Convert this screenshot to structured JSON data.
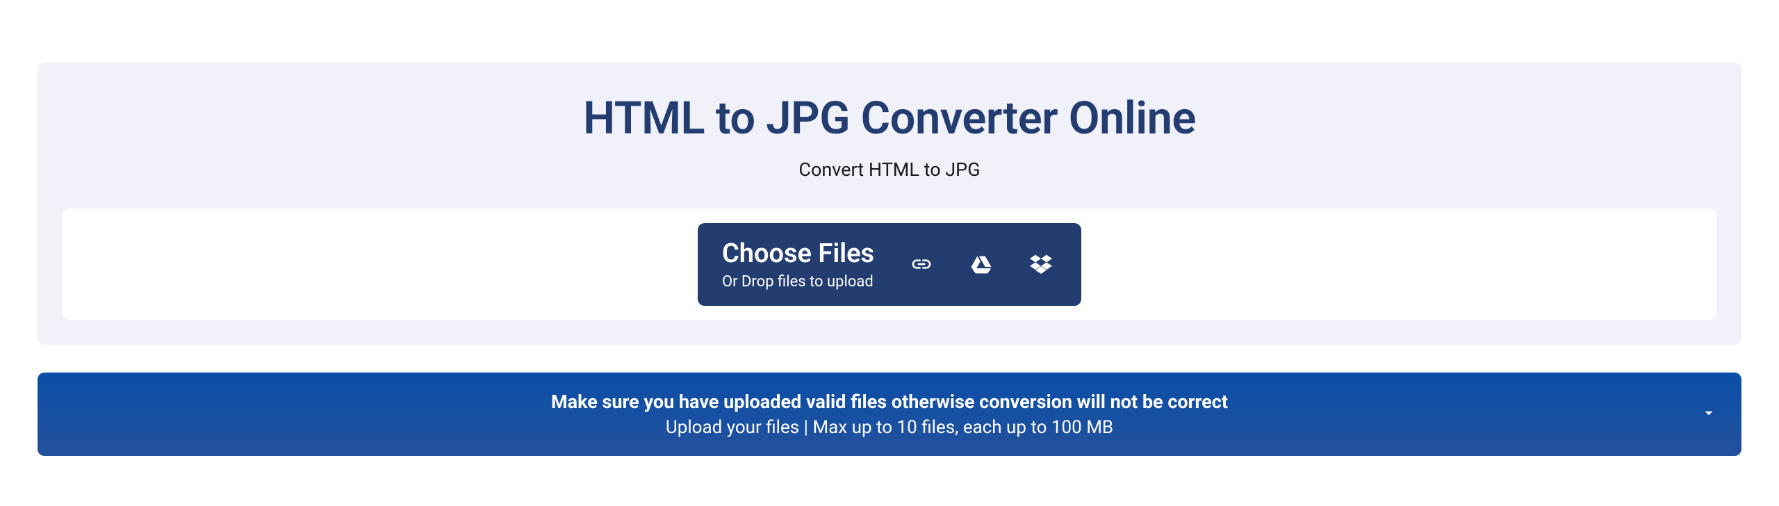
{
  "header": {
    "title": "HTML to JPG Converter Online",
    "subtitle": "Convert HTML to JPG"
  },
  "upload": {
    "choose_label": "Choose Files",
    "drop_label": "Or Drop files to upload"
  },
  "info_bar": {
    "line1": "Make sure you have uploaded valid files otherwise conversion will not be correct",
    "line2": "Upload your files | Max up to 10 files, each up to 100 MB"
  }
}
